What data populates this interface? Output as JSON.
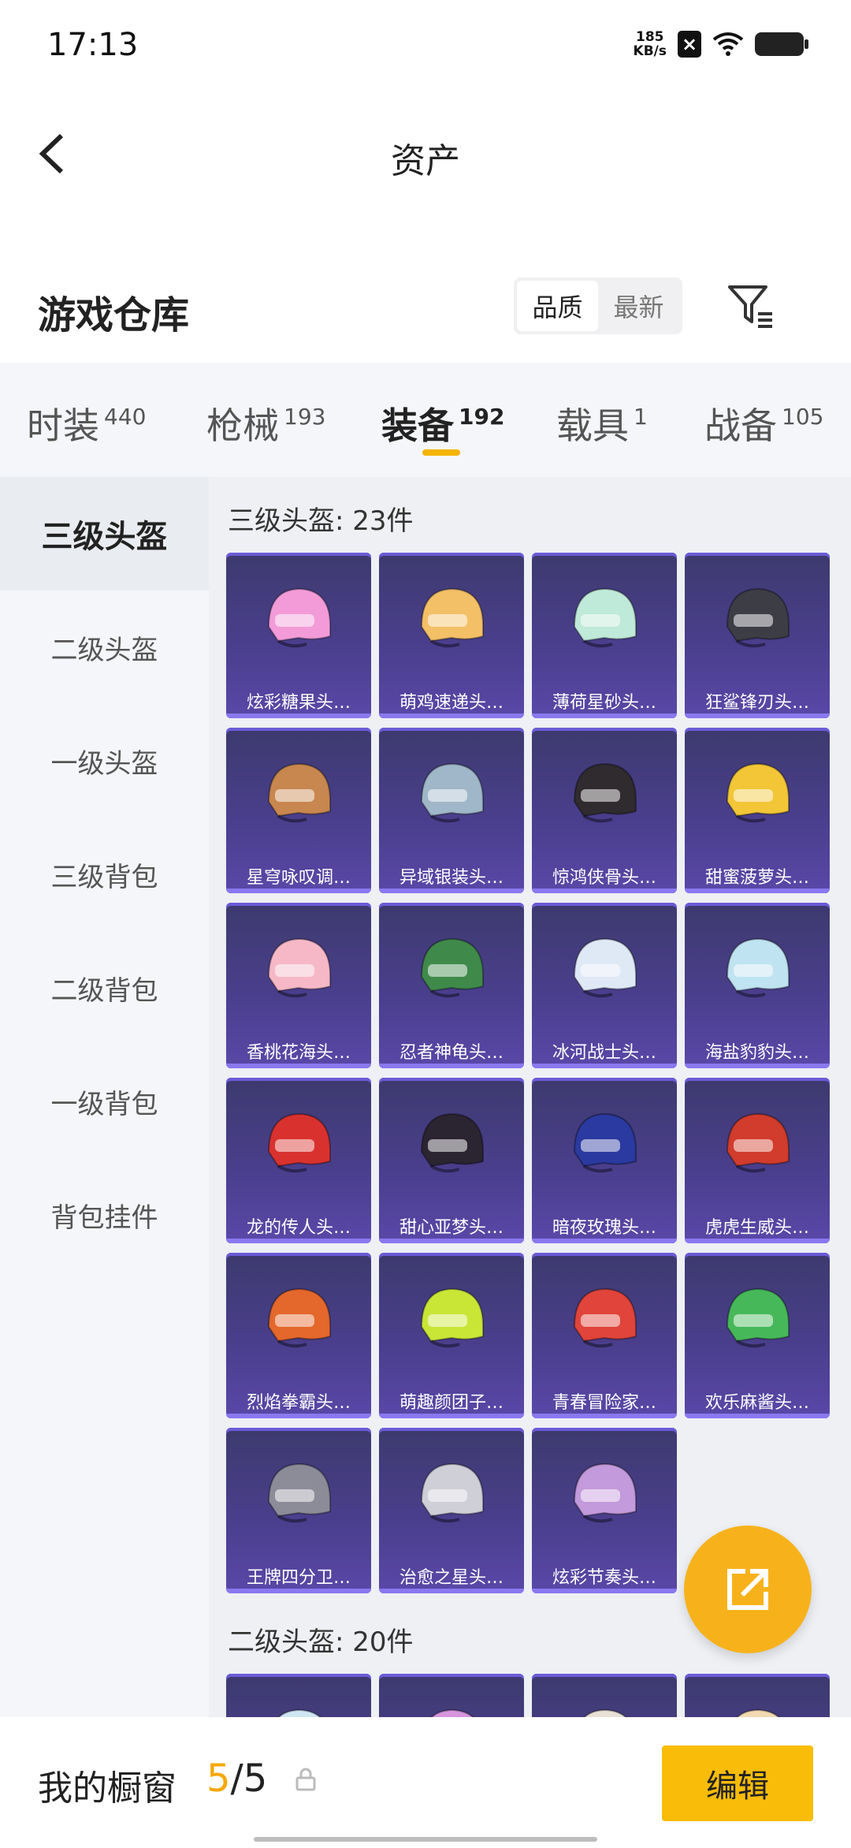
{
  "status": {
    "time": "17:13",
    "netspeed_value": "185",
    "netspeed_unit": "KB/s"
  },
  "header": {
    "title": "资产"
  },
  "warehouse": {
    "title": "游戏仓库",
    "sort": [
      "品质",
      "最新"
    ]
  },
  "categories": [
    {
      "label": "时装",
      "count": "440"
    },
    {
      "label": "枪械",
      "count": "193"
    },
    {
      "label": "装备",
      "count": "192"
    },
    {
      "label": "载具",
      "count": "1"
    },
    {
      "label": "战备",
      "count": "105"
    }
  ],
  "sidebar": [
    "三级头盔",
    "二级头盔",
    "一级头盔",
    "三级背包",
    "二级背包",
    "一级背包",
    "背包挂件"
  ],
  "sections": [
    {
      "title": "三级头盔: 23件",
      "items": [
        {
          "name": "炫彩糖果头…",
          "color": "#f29bd8"
        },
        {
          "name": "萌鸡速递头…",
          "color": "#f3c067"
        },
        {
          "name": "薄荷星砂头…",
          "color": "#bfe9d8"
        },
        {
          "name": "狂鲨锋刃头…",
          "color": "#3d3d45"
        },
        {
          "name": "星穹咏叹调…",
          "color": "#c7874e"
        },
        {
          "name": "异域银装头…",
          "color": "#9fb7c8"
        },
        {
          "name": "惊鸿侠骨头…",
          "color": "#2f2b2e"
        },
        {
          "name": "甜蜜菠萝头…",
          "color": "#f2c637"
        },
        {
          "name": "香桃花海头…",
          "color": "#f6b8c7"
        },
        {
          "name": "忍者神龟头…",
          "color": "#3f8a4a"
        },
        {
          "name": "冰河战士头…",
          "color": "#dfe9f6"
        },
        {
          "name": "海盐豹豹头…",
          "color": "#bfe3f0"
        },
        {
          "name": "龙的传人头…",
          "color": "#d9322e"
        },
        {
          "name": "甜心亚梦头…",
          "color": "#2b2431"
        },
        {
          "name": "暗夜玫瑰头…",
          "color": "#2a3aa0"
        },
        {
          "name": "虎虎生威头…",
          "color": "#d13c2c"
        },
        {
          "name": "烈焰拳霸头…",
          "color": "#e4672b"
        },
        {
          "name": "萌趣颜团子…",
          "color": "#c9e637"
        },
        {
          "name": "青春冒险家…",
          "color": "#e0443a"
        },
        {
          "name": "欢乐麻酱头…",
          "color": "#47b85a"
        },
        {
          "name": "王牌四分卫…",
          "color": "#8c8c99"
        },
        {
          "name": "治愈之星头…",
          "color": "#cfcfd8"
        },
        {
          "name": "炫彩节奏头…",
          "color": "#c39adb"
        }
      ]
    },
    {
      "title": "二级头盔: 20件",
      "items": [
        {
          "name": "",
          "color": "#cfe6f2"
        },
        {
          "name": "",
          "color": "#d695de"
        },
        {
          "name": "",
          "color": "#e7e2d5"
        },
        {
          "name": "",
          "color": "#f2d9b2"
        }
      ]
    }
  ],
  "showcase": {
    "label": "我的橱窗",
    "used": "5",
    "sep": "/",
    "total": "5",
    "edit": "编辑"
  },
  "colors": {
    "accent": "#f5b400",
    "card_bg": "#4b3f8f"
  }
}
